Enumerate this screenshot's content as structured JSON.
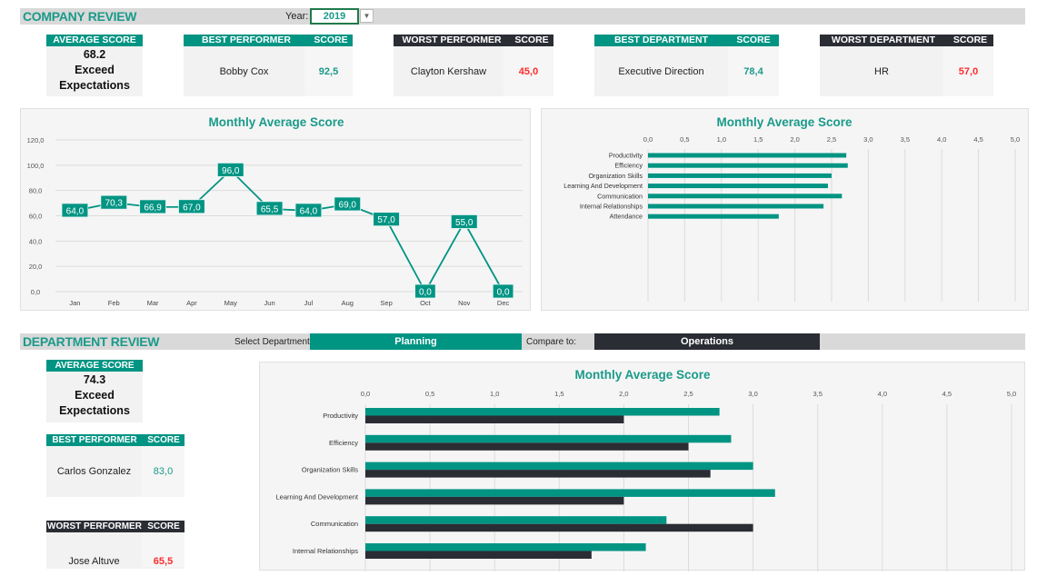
{
  "company": {
    "title": "COMPANY REVIEW",
    "year_label": "Year:",
    "year_value": "2019",
    "average": {
      "header": "AVERAGE SCORE",
      "value": "68.2",
      "rating_line1": "Exceed",
      "rating_line2": "Expectations"
    },
    "best_performer": {
      "header": "BEST PERFORMER",
      "score_header": "SCORE",
      "name": "Bobby Cox",
      "score": "92,5"
    },
    "worst_performer": {
      "header": "WORST PERFORMER",
      "score_header": "SCORE",
      "name": "Clayton Kershaw",
      "score": "45,0"
    },
    "best_department": {
      "header": "BEST DEPARTMENT",
      "score_header": "SCORE",
      "name": "Executive Direction",
      "score": "78,4"
    },
    "worst_department": {
      "header": "WORST DEPARTMENT",
      "score_header": "SCORE",
      "name": "HR",
      "score": "57,0"
    }
  },
  "department": {
    "title": "DEPARTMENT REVIEW",
    "select_label": "Select Department:",
    "selected": "Planning",
    "compare_label": "Compare to:",
    "compare_value": "Operations",
    "average": {
      "header": "AVERAGE SCORE",
      "value": "74.3",
      "rating_line1": "Exceed",
      "rating_line2": "Expectations"
    },
    "best_performer": {
      "header": "BEST PERFORMER",
      "score_header": "SCORE",
      "name": "Carlos Gonzalez",
      "score": "83,0"
    },
    "worst_performer": {
      "header": "WORST PERFORMER",
      "score_header": "SCORE",
      "name": "Jose Altuve",
      "score": "65,5"
    }
  },
  "colors": {
    "teal": "#009483",
    "dark": "#2b2d35",
    "good": "#1a9a8a",
    "bad": "#ff2b2b"
  },
  "chart_data": [
    {
      "type": "line",
      "title": "Monthly Average Score",
      "categories": [
        "Jan",
        "Feb",
        "Mar",
        "Apr",
        "May",
        "Jun",
        "Jul",
        "Aug",
        "Sep",
        "Oct",
        "Nov",
        "Dec"
      ],
      "values": [
        64.0,
        70.3,
        66.9,
        67.0,
        96.0,
        65.5,
        64.0,
        69.0,
        57.0,
        0.0,
        55.0,
        0.0
      ],
      "labels": [
        "64,0",
        "70,3",
        "66,9",
        "67,0",
        "96,0",
        "65,5",
        "64,0",
        "69,0",
        "57,0",
        "0,0",
        "55,0",
        "0,0"
      ],
      "ylim": [
        0,
        120
      ],
      "yticks": [
        "0,0",
        "20,0",
        "40,0",
        "60,0",
        "80,0",
        "100,0",
        "120,0"
      ],
      "grid": true
    },
    {
      "type": "bar",
      "orientation": "horizontal",
      "title": "Monthly Average Score",
      "categories": [
        "Productivity",
        "Efficiency",
        "Organization Skills",
        "Learning And Development",
        "Communication",
        "Internal Relationships",
        "Attendance"
      ],
      "values": [
        2.7,
        2.72,
        2.5,
        2.45,
        2.64,
        2.39,
        1.78
      ],
      "xlim": [
        0,
        5
      ],
      "xticks": [
        "0,0",
        "0,5",
        "1,0",
        "1,5",
        "2,0",
        "2,5",
        "3,0",
        "3,5",
        "4,0",
        "4,5",
        "5,0"
      ],
      "grid": true
    },
    {
      "type": "bar",
      "orientation": "horizontal",
      "title": "Monthly Average Score",
      "categories": [
        "Productivity",
        "Efficiency",
        "Organization Skills",
        "Learning And Development",
        "Communication",
        "Internal Relationships"
      ],
      "series": [
        {
          "name": "Planning",
          "values": [
            2.74,
            2.83,
            3.0,
            3.17,
            2.33,
            2.17
          ]
        },
        {
          "name": "Operations",
          "values": [
            2.0,
            2.5,
            2.67,
            2.0,
            3.0,
            1.75
          ]
        }
      ],
      "xlim": [
        0,
        5
      ],
      "xticks": [
        "0,0",
        "0,5",
        "1,0",
        "1,5",
        "2,0",
        "2,5",
        "3,0",
        "3,5",
        "4,0",
        "4,5",
        "5,0"
      ],
      "grid": true
    }
  ]
}
